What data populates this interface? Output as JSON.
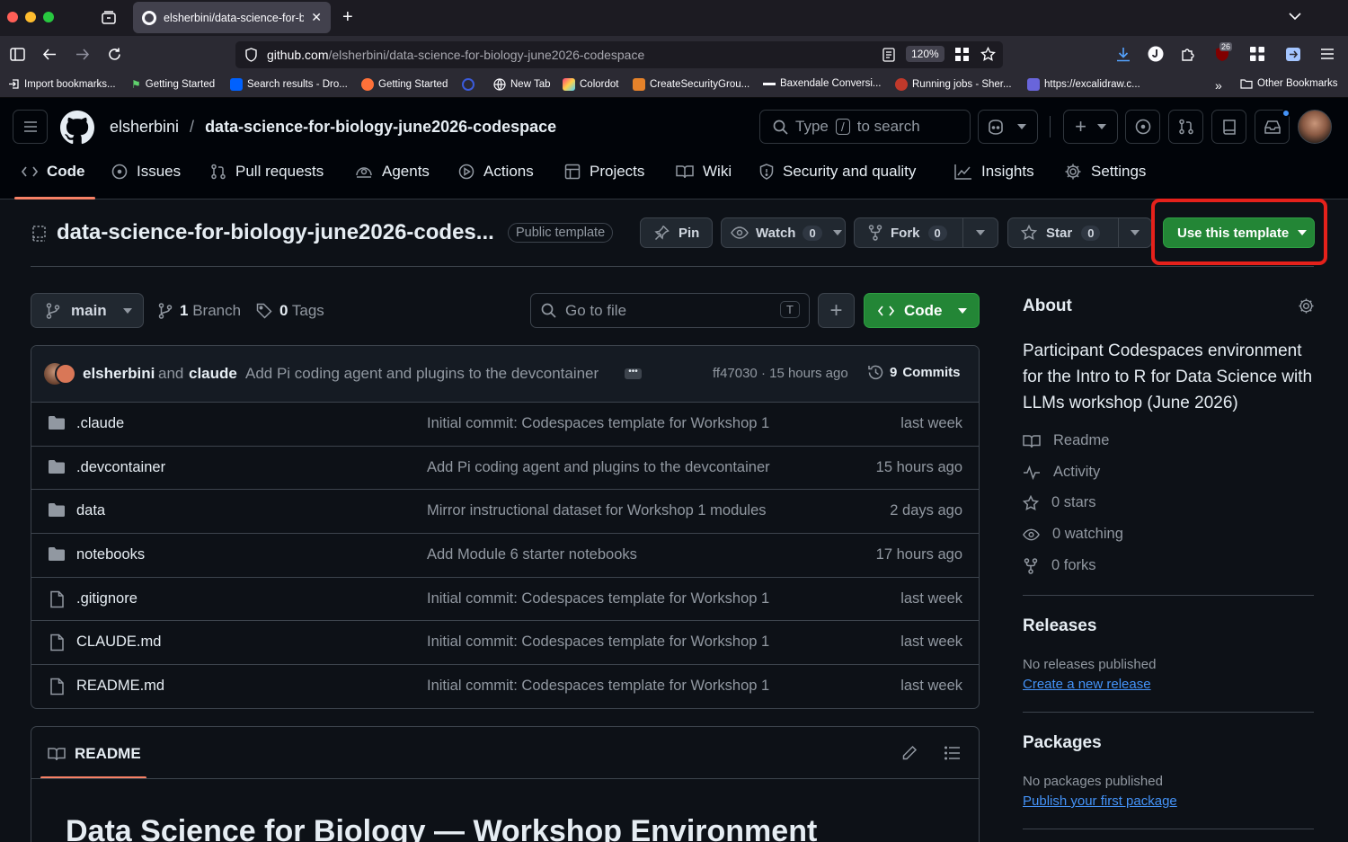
{
  "browser": {
    "tab_title": "elsherbini/data-science-for-biol",
    "url_domain": "github.com",
    "url_path": "/elsherbini/data-science-for-biology-june2026-codespace",
    "zoom": "120%",
    "notification_count": "26",
    "bookmarks": [
      {
        "label": "Import bookmarks...",
        "icon": "import-icon"
      },
      {
        "label": "Getting Started",
        "icon": "flag-icon"
      },
      {
        "label": "Search results - Dro...",
        "icon": "dropbox-icon"
      },
      {
        "label": "Getting Started",
        "icon": "firefox-icon"
      },
      {
        "label": "",
        "icon": "circle-logo-icon"
      },
      {
        "label": "New Tab",
        "icon": "globe-icon"
      },
      {
        "label": "Colordot",
        "icon": "colordot-icon"
      },
      {
        "label": "CreateSecurityGrou...",
        "icon": "aws-icon"
      },
      {
        "label": "Baxendale Conversi...",
        "icon": "dash-icon"
      },
      {
        "label": "Running jobs - Sher...",
        "icon": "jobs-icon"
      },
      {
        "label": "https://excalidraw.c...",
        "icon": "excalidraw-icon"
      }
    ],
    "other_bookmarks": "Other Bookmarks"
  },
  "header": {
    "owner": "elsherbini",
    "separator": "/",
    "repo": "data-science-for-biology-june2026-codespace",
    "search_type": "Type",
    "search_key": "/",
    "search_suffix": "to search"
  },
  "nav": {
    "tabs": [
      {
        "label": "Code",
        "icon": "code-icon"
      },
      {
        "label": "Issues",
        "icon": "issue-icon"
      },
      {
        "label": "Pull requests",
        "icon": "pull-request-icon"
      },
      {
        "label": "Agents",
        "icon": "agents-icon"
      },
      {
        "label": "Actions",
        "icon": "play-icon"
      },
      {
        "label": "Projects",
        "icon": "table-icon"
      },
      {
        "label": "Wiki",
        "icon": "book-icon"
      },
      {
        "label": "Security and quality",
        "icon": "shield-icon"
      },
      {
        "label": "Insights",
        "icon": "graph-icon"
      },
      {
        "label": "Settings",
        "icon": "gear-icon"
      }
    ]
  },
  "repo_header": {
    "title": "data-science-for-biology-june2026-codes...",
    "badge": "Public template",
    "pin": "Pin",
    "watch": "Watch",
    "watch_count": "0",
    "fork": "Fork",
    "fork_count": "0",
    "star": "Star",
    "star_count": "0",
    "use_template": "Use this template"
  },
  "branch_bar": {
    "branch": "main",
    "branches_count": "1",
    "branches_label": "Branch",
    "tags_count": "0",
    "tags_label": "Tags",
    "goto_placeholder": "Go to file",
    "goto_key": "T",
    "code_button": "Code"
  },
  "commit": {
    "author1": "elsherbini",
    "and": "and",
    "author2": "claude",
    "message": "Add Pi coding agent and plugins to the devcontainer",
    "hash_time": "ff47030 · 15 hours ago",
    "commits_count": "9",
    "commits_label": "Commits"
  },
  "files": [
    {
      "name": ".claude",
      "type": "folder",
      "message": "Initial commit: Codespaces template for Workshop 1",
      "date": "last week"
    },
    {
      "name": ".devcontainer",
      "type": "folder",
      "message": "Add Pi coding agent and plugins to the devcontainer",
      "date": "15 hours ago"
    },
    {
      "name": "data",
      "type": "folder",
      "message": "Mirror instructional dataset for Workshop 1 modules",
      "date": "2 days ago"
    },
    {
      "name": "notebooks",
      "type": "folder",
      "message": "Add Module 6 starter notebooks",
      "date": "17 hours ago"
    },
    {
      "name": ".gitignore",
      "type": "file",
      "message": "Initial commit: Codespaces template for Workshop 1",
      "date": "last week"
    },
    {
      "name": "CLAUDE.md",
      "type": "file",
      "message": "Initial commit: Codespaces template for Workshop 1",
      "date": "last week"
    },
    {
      "name": "README.md",
      "type": "file",
      "message": "Initial commit: Codespaces template for Workshop 1",
      "date": "last week"
    }
  ],
  "readme": {
    "tab_label": "README",
    "heading": "Data Science for Biology — Workshop Environment"
  },
  "about": {
    "title": "About",
    "description": "Participant Codespaces environment for the Intro to R for Data Science with LLMs workshop (June 2026)",
    "readme": "Readme",
    "activity": "Activity",
    "stars": "0 stars",
    "watching": "0 watching",
    "forks": "0 forks"
  },
  "releases": {
    "title": "Releases",
    "empty": "No releases published",
    "link": "Create a new release"
  },
  "packages": {
    "title": "Packages",
    "empty": "No packages published",
    "link": "Publish your first package"
  },
  "colors": {
    "accent_green": "#238636",
    "link_blue": "#4493f8",
    "highlight_red": "#e5211b",
    "tab_underline": "#f78166"
  }
}
